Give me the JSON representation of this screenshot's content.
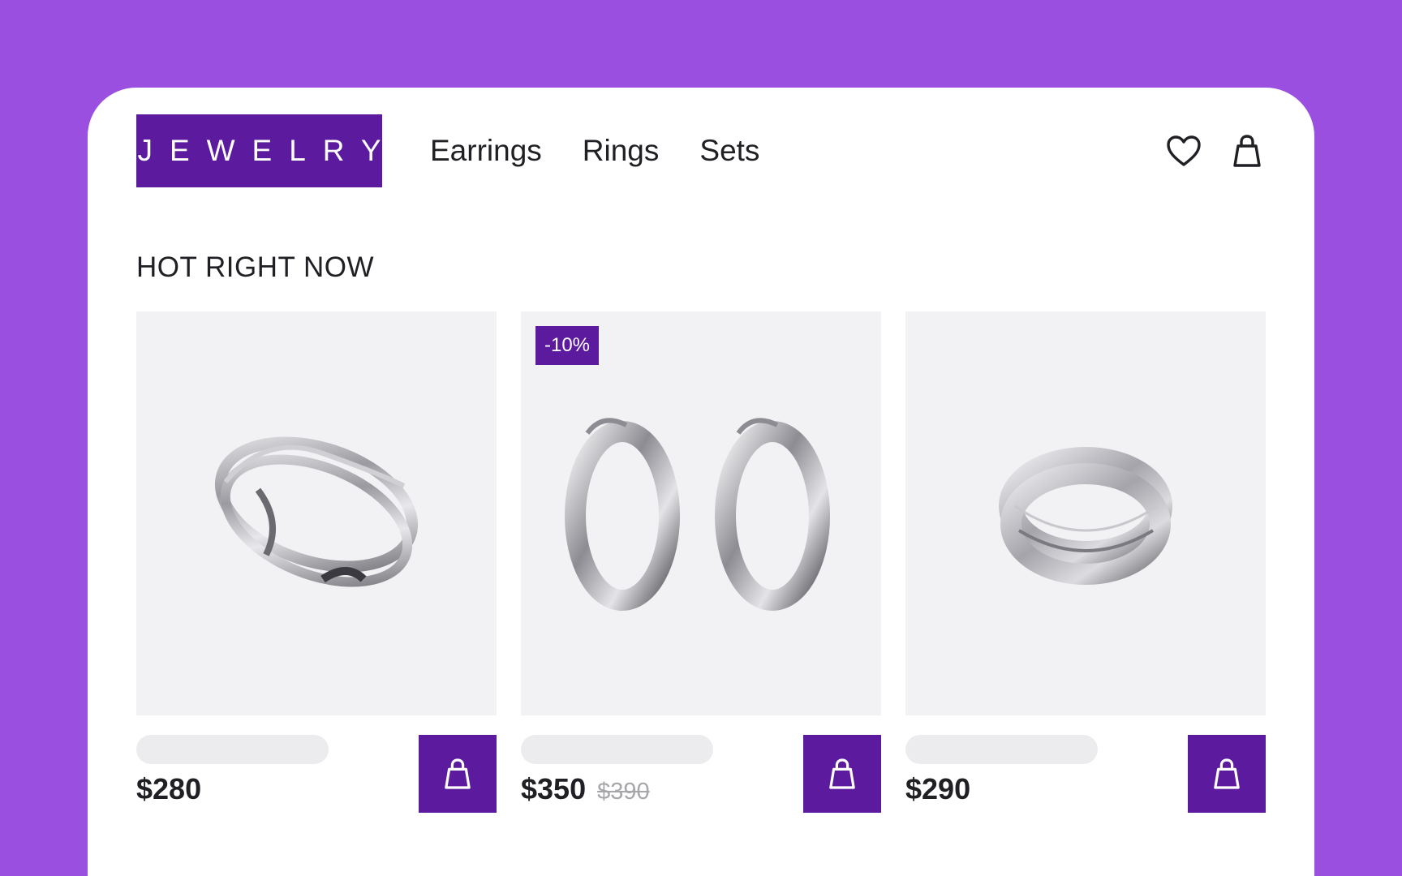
{
  "header": {
    "logo": "JEWELRY",
    "nav": [
      {
        "label": "Earrings"
      },
      {
        "label": "Rings"
      },
      {
        "label": "Sets"
      }
    ],
    "icons": [
      "heart-icon",
      "shopping-bag-icon"
    ]
  },
  "section": {
    "title": "HOT RIGHT NOW"
  },
  "products": [
    {
      "price": "$280",
      "old_price": "",
      "badge": "",
      "image": "silver-wave-ring"
    },
    {
      "price": "$350",
      "old_price": "$390",
      "badge": "-10%",
      "image": "silver-hoop-earrings"
    },
    {
      "price": "$290",
      "old_price": "",
      "badge": "",
      "image": "silver-wrap-ring"
    }
  ],
  "colors": {
    "background": "#9b4fe0",
    "brand": "#5c1a9e",
    "card": "#ffffff",
    "image_bg": "#f2f2f4"
  }
}
